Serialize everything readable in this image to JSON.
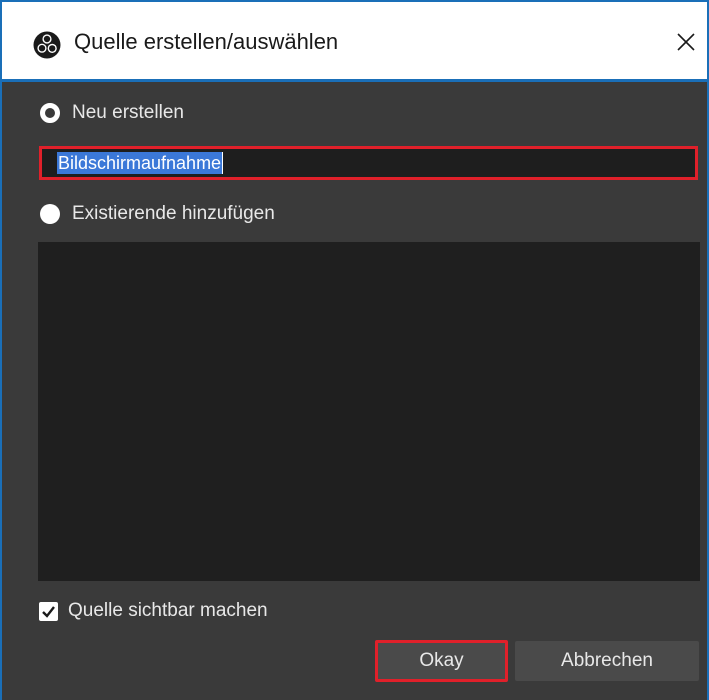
{
  "window": {
    "title": "Quelle erstellen/auswählen",
    "icon": "obs-logo-icon",
    "close_glyph": "close-icon"
  },
  "form": {
    "create_new_label": "Neu erstellen",
    "create_new_selected": true,
    "name_value": "Bildschirmaufnahme",
    "add_existing_label": "Existierende hinzufügen",
    "add_existing_selected": false,
    "existing_sources": [],
    "visible_checkbox_label": "Quelle sichtbar machen",
    "visible_checked": true
  },
  "buttons": {
    "ok_label": "Okay",
    "cancel_label": "Abbrechen"
  },
  "colors": {
    "highlight_border": "#e0202a",
    "selection": "#3b78d8",
    "window_accent": "#1a6fb8"
  }
}
